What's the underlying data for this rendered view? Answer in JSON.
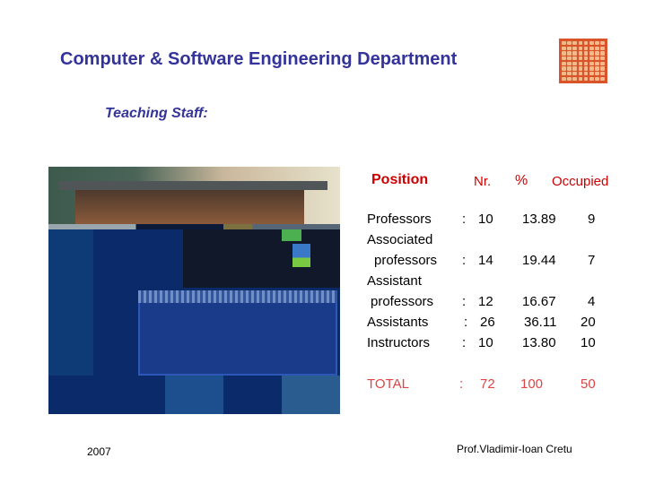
{
  "header": {
    "title": "Computer & Software Engineering Department",
    "logo_icon": "university-grid-logo-icon"
  },
  "subtitle": "Teaching Staff:",
  "photo": {
    "alt": "server-rack-photo"
  },
  "table": {
    "headers": {
      "position": "Position",
      "nr": "Nr.",
      "percent": "%",
      "occupied": "Occupied"
    },
    "rows": [
      {
        "position_line1": "Professors",
        "position_line2": "",
        "sep": ":",
        "nr": "10",
        "percent": "13.89",
        "occupied": "9"
      },
      {
        "position_line1": "Associated",
        "position_line2": "professors",
        "sep": ":",
        "nr": "14",
        "percent": "19.44",
        "occupied": "7"
      },
      {
        "position_line1": "Assistant",
        "position_line2": "professors",
        "sep": ":",
        "nr": "12",
        "percent": "16.67",
        "occupied": "4"
      },
      {
        "position_line1": "Assistants",
        "position_line2": "",
        "sep": ":",
        "nr": "26",
        "percent": "36.11",
        "occupied": "20"
      },
      {
        "position_line1": "Instructors",
        "position_line2": "",
        "sep": ":",
        "nr": "10",
        "percent": "13.80",
        "occupied": "10"
      }
    ],
    "total": {
      "label": "TOTAL",
      "sep": ":",
      "nr": "72",
      "percent": "100",
      "occupied": "50"
    }
  },
  "footer": {
    "year": "2007",
    "author": "Prof.Vladimir-Ioan Cretu"
  },
  "colors": {
    "title": "#333399",
    "header": "#cc0000",
    "total": "#dd4444",
    "logo": "#d9542a"
  }
}
